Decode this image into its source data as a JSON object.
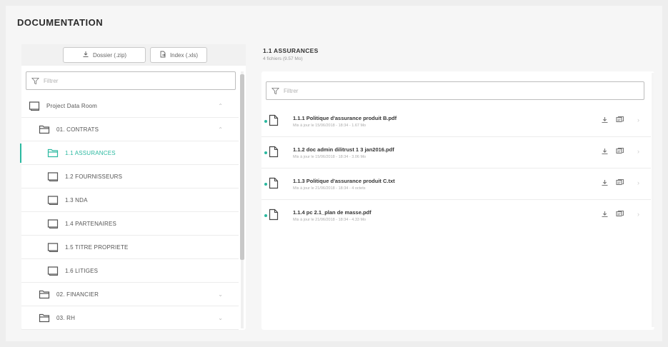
{
  "page": {
    "title": "DOCUMENTATION"
  },
  "toolbar": {
    "dossier_label": "Dossier (.zip)",
    "index_label": "Index (.xls)"
  },
  "left_filter": {
    "placeholder": "Filtrer"
  },
  "tree": [
    {
      "label": "Project Data Room",
      "level": 0,
      "icon": "folder-closed-icon",
      "expanded": true
    },
    {
      "label": "01. CONTRATS",
      "level": 1,
      "icon": "folder-open-icon",
      "expanded": true
    },
    {
      "label": "1.1 ASSURANCES",
      "level": 2,
      "icon": "folder-open-icon",
      "active": true
    },
    {
      "label": "1.2 FOURNISSEURS",
      "level": 2,
      "icon": "folder-closed-icon"
    },
    {
      "label": "1.3 NDA",
      "level": 2,
      "icon": "folder-closed-icon"
    },
    {
      "label": "1.4 PARTENAIRES",
      "level": 2,
      "icon": "folder-closed-icon"
    },
    {
      "label": "1.5 TITRE PROPRIETE",
      "level": 2,
      "icon": "folder-closed-icon"
    },
    {
      "label": "1.6 LITIGES",
      "level": 2,
      "icon": "folder-closed-icon"
    },
    {
      "label": "02. FINANCIER",
      "level": 1,
      "icon": "folder-open-icon"
    },
    {
      "label": "03. RH",
      "level": 1,
      "icon": "folder-open-icon"
    }
  ],
  "right": {
    "title": "1.1 ASSURANCES",
    "subtitle": "4 fichiers (9.57 Mo)",
    "filter_placeholder": "Filtrer"
  },
  "files": [
    {
      "name": "1.1.1 Politique d'assurance produit B.pdf",
      "meta": "Mis à jour le 15/06/2018 - 18:34 - 1.67 Mo"
    },
    {
      "name": "1.1.2 doc admin dilitrust 1 3 jan2016.pdf",
      "meta": "Mis à jour le 15/06/2018 - 18:34 - 3.06 Mo"
    },
    {
      "name": "1.1.3 Politique d'assurance produit C.txt",
      "meta": "Mis à jour le 21/06/2018 - 18:34 - 4 octets"
    },
    {
      "name": "1.1.4 pc 2.1_plan de masse.pdf",
      "meta": "Mis à jour le 21/06/2018 - 18:34 - 4.33 Mo"
    }
  ],
  "colors": {
    "accent": "#2bb9a0",
    "background": "#eeeeee",
    "panel": "#ffffff"
  }
}
